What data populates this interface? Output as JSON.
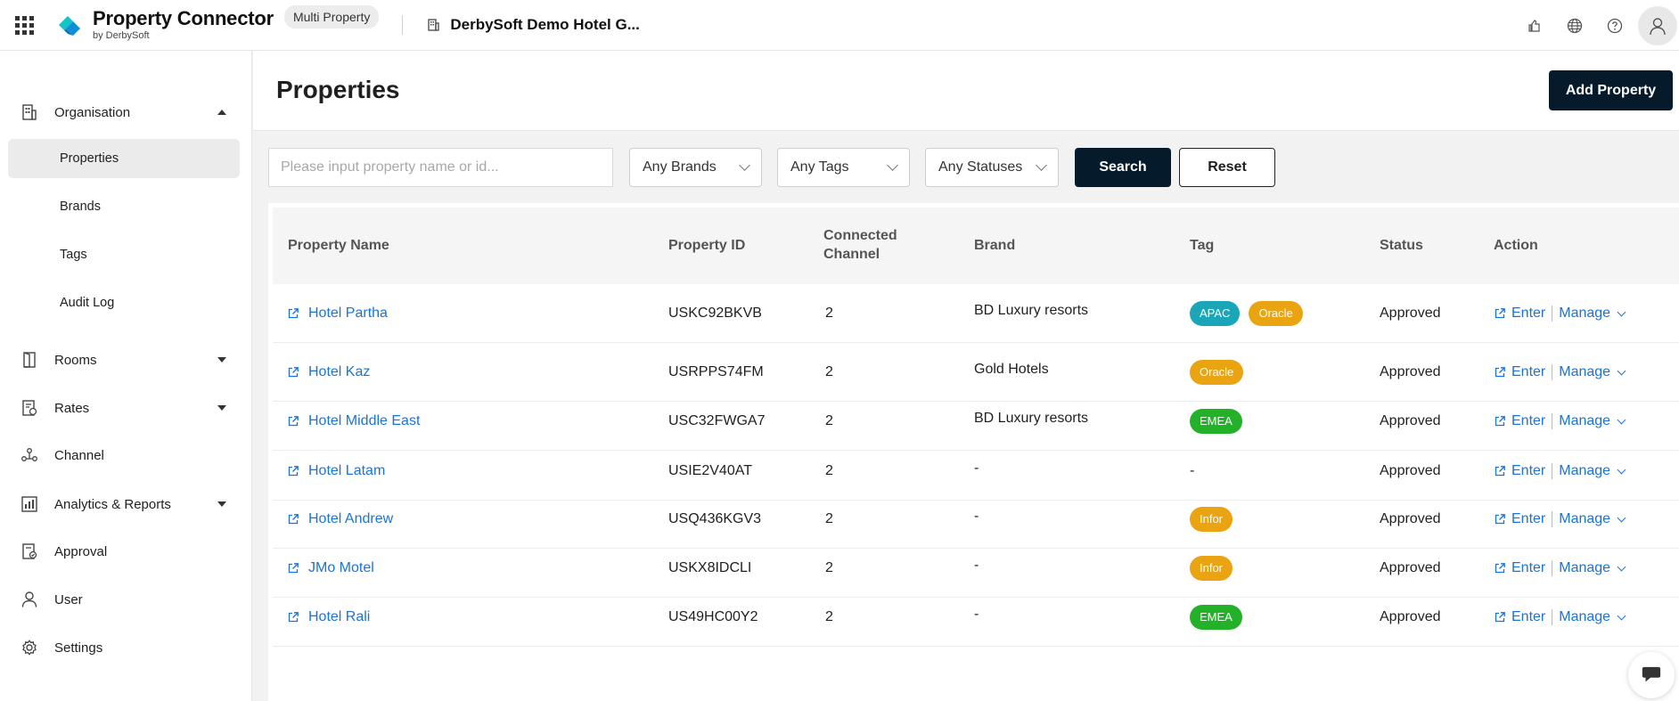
{
  "header": {
    "app_title": "Property Connector",
    "app_subtitle": "by DerbySoft",
    "mode_badge": "Multi Property",
    "group_name": "DerbySoft Demo Hotel G...",
    "icons": [
      "apps-grid-icon",
      "share-icon",
      "globe-icon",
      "help-icon",
      "user-avatar-icon"
    ]
  },
  "sidebar": {
    "organisation": "Organisation",
    "sub_items": [
      "Properties",
      "Brands",
      "Tags",
      "Audit Log"
    ],
    "rooms": "Rooms",
    "rates": "Rates",
    "channel": "Channel",
    "analytics": "Analytics & Reports",
    "approval": "Approval",
    "user": "User",
    "settings": "Settings"
  },
  "page": {
    "title": "Properties",
    "add_button": "Add Property"
  },
  "filters": {
    "search_placeholder": "Please input property name or id...",
    "brands": "Any Brands",
    "tags": "Any Tags",
    "statuses": "Any Statuses",
    "search_button": "Search",
    "reset_button": "Reset"
  },
  "table": {
    "columns": {
      "name": "Property Name",
      "id": "Property ID",
      "channel_1": "Connected",
      "channel_2": "Channel",
      "brand": "Brand",
      "tag": "Tag",
      "status": "Status",
      "action": "Action"
    },
    "enter_label": "Enter",
    "manage_label": "Manage",
    "rows": [
      {
        "name": "Hotel Partha",
        "id": "USKC92BKVB",
        "channel": "2",
        "brand": "BD Luxury resorts",
        "tag1": "APAC",
        "tag2": "Oracle",
        "status": "Approved"
      },
      {
        "name": "Hotel Kaz",
        "id": "USRPPS74FM",
        "channel": "2",
        "brand": "Gold Hotels",
        "tag1": "Oracle",
        "status": "Approved"
      },
      {
        "name": "Hotel Middle East",
        "id": "USC32FWGA7",
        "channel": "2",
        "brand": "BD Luxury resorts",
        "tag1": "EMEA",
        "status": "Approved"
      },
      {
        "name": "Hotel Latam",
        "id": "USIE2V40AT",
        "channel": "2",
        "brand": "-",
        "tag_text": "-",
        "status": "Approved"
      },
      {
        "name": "Hotel Andrew",
        "id": "USQ436KGV3",
        "channel": "2",
        "brand": "-",
        "tag1": "Infor",
        "status": "Approved"
      },
      {
        "name": "JMo Motel",
        "id": "USKX8IDCLI",
        "channel": "2",
        "brand": "-",
        "tag1": "Infor",
        "status": "Approved"
      },
      {
        "name": "Hotel Rali",
        "id": "US49HC00Y2",
        "channel": "2",
        "brand": "-",
        "tag1": "EMEA",
        "status": "Approved"
      }
    ]
  },
  "colors": {
    "primary_button": "#051b2c",
    "link": "#1a73d9",
    "tag_apac": "#1aa5b8",
    "tag_oracle": "#eaa311",
    "tag_emea": "#23b12a",
    "tag_infor": "#eaa311"
  }
}
